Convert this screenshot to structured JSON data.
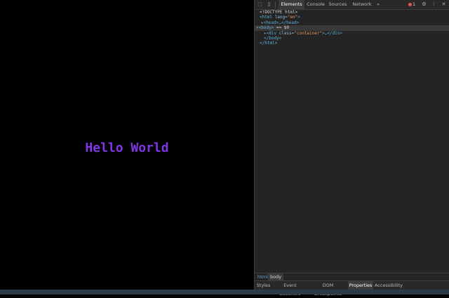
{
  "page": {
    "text": "Hello World",
    "text_color": "#8137e6"
  },
  "devtools": {
    "toolbar": {
      "tabs": [
        {
          "label": "Elements",
          "active": true
        },
        {
          "label": "Console",
          "active": false
        },
        {
          "label": "Sources",
          "active": false
        },
        {
          "label": "Network",
          "active": false
        }
      ],
      "more_label": "»",
      "error_count": "1",
      "settings_icon": "gear-icon",
      "menu_icon": "kebab-menu-icon",
      "close_icon": "close-icon",
      "inspect_icon": "inspect-element-icon",
      "device_icon": "device-toolbar-icon"
    },
    "dom_tree": {
      "doctype": "<!DOCTYPE html>",
      "html_open": "<html",
      "lang_attr": " lang=",
      "lang_val": "\"en\"",
      "close_gt": ">",
      "head_node": "<head>…</head>",
      "body_open": "<body>",
      "body_suffix": " == $0",
      "div_open": "<div",
      "class_attr": " class=",
      "class_val": "\"container\"",
      "div_rest": ">…</div>",
      "body_close": "</body>",
      "html_close": "</html>"
    },
    "breadcrumbs": [
      "html",
      "body"
    ],
    "panel_tabs": [
      {
        "label": "Styles",
        "active": false
      },
      {
        "label": "Event Listeners",
        "active": false
      },
      {
        "label": "DOM Breakpoints",
        "active": false
      },
      {
        "label": "Properties",
        "active": true
      },
      {
        "label": "Accessibility",
        "active": false
      }
    ]
  }
}
